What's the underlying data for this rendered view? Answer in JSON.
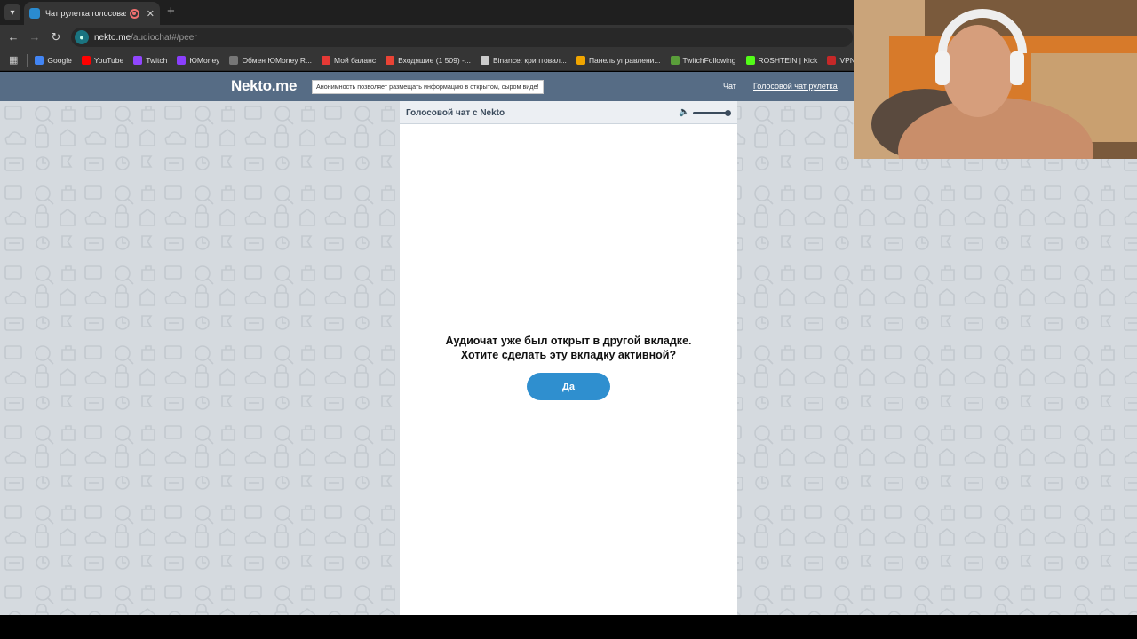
{
  "browser": {
    "tab": {
      "title": "Чат рулетка голосовая — |"
    },
    "address": {
      "host": "nekto.me",
      "path": "/audiochat#/peer"
    },
    "bookmarks": [
      {
        "label": "Google",
        "color": "#4285f4"
      },
      {
        "label": "YouTube",
        "color": "#ff0000"
      },
      {
        "label": "Twitch",
        "color": "#9146ff"
      },
      {
        "label": "ЮMoney",
        "color": "#8b3ffd"
      },
      {
        "label": "Обмен ЮMoney R...",
        "color": "#777777"
      },
      {
        "label": "Мой баланс",
        "color": "#e53935"
      },
      {
        "label": "Входящие (1 509) -...",
        "color": "#ea4335"
      },
      {
        "label": "Binance: криптовал...",
        "color": "#cccccc"
      },
      {
        "label": "Панель управлени...",
        "color": "#f0a500"
      },
      {
        "label": "TwitchFollowing",
        "color": "#5a9e3a"
      },
      {
        "label": "ROSHTEIN | Kick",
        "color": "#53fc18"
      },
      {
        "label": "VPNGame -",
        "color": "#c62828"
      }
    ]
  },
  "site": {
    "logo": "Nekto.me",
    "slogan": "Анонимность позволяет размещать информацию в открытом, сыром виде!",
    "nav": {
      "chat": "Чат",
      "voice": "Голосовой чат рулетка"
    }
  },
  "panel": {
    "title": "Голосовой чат с Nekto",
    "question_line1": "Аудиочат уже был открыт в другой вкладке.",
    "question_line2": "Хотите сделать эту вкладку активной?",
    "yes_label": "Да",
    "volume_level": 1.0
  },
  "colors": {
    "header": "#566c85",
    "accent": "#2f8fcf",
    "background": "#d5dadf"
  }
}
